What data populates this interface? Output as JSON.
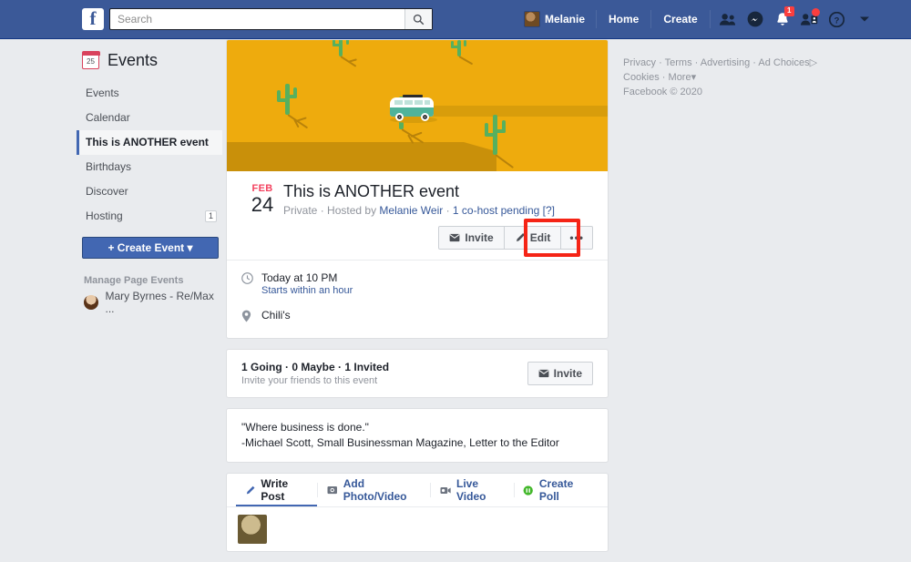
{
  "nav": {
    "logo": "f",
    "search_placeholder": "Search",
    "search_icon": "search-icon",
    "user_name": "Melanie",
    "home_label": "Home",
    "create_label": "Create",
    "friend_requests_icon": "friend-requests-icon",
    "messenger_icon": "messenger-icon",
    "notifications_icon": "notifications-icon",
    "notifications_badge": "1",
    "account_icon": "account-icon",
    "help_icon": "help-icon",
    "dropdown_icon": "chevron-down-icon"
  },
  "sidebar": {
    "title": "Events",
    "calendar_icon_day": "25",
    "items": [
      {
        "label": "Events",
        "selected": false,
        "badge": ""
      },
      {
        "label": "Calendar",
        "selected": false,
        "badge": ""
      },
      {
        "label": "This is ANOTHER event",
        "selected": true,
        "badge": ""
      },
      {
        "label": "Birthdays",
        "selected": false,
        "badge": ""
      },
      {
        "label": "Discover",
        "selected": false,
        "badge": ""
      },
      {
        "label": "Hosting",
        "selected": false,
        "badge": "1"
      }
    ],
    "create_event_button": "+  Create Event  ▾",
    "manage_label": "Manage Page Events",
    "pages": [
      {
        "name": "Mary Byrnes - Re/Max ..."
      }
    ]
  },
  "event": {
    "cover_alt": "desert-cover-photo",
    "month": "FEB",
    "day": "24",
    "title": "This is ANOTHER event",
    "privacy": "Private",
    "hosted_by_prefix": "Hosted by",
    "host_name": "Melanie Weir",
    "cohost_pending": "1 co-host pending [?]",
    "separator": "·",
    "invite_button": "Invite",
    "edit_button": "Edit",
    "more_button": "•••",
    "highlight_color": "#f52416",
    "time_text": "Today at 10 PM",
    "time_sub": "Starts within an hour",
    "location": "Chili's",
    "clock_icon": "clock-icon",
    "pin_icon": "location-pin-icon",
    "envelope_icon": "envelope-icon",
    "pencil_icon": "pencil-icon"
  },
  "going": {
    "summary": "1 Going · 0 Maybe · 1 Invited",
    "sub": "Invite your friends to this event",
    "invite_button": "Invite"
  },
  "description": {
    "line1": "\"Where business is done.\"",
    "line2": "-Michael Scott, Small Businessman Magazine, Letter to the Editor"
  },
  "composer": {
    "tabs": [
      {
        "label": "Write Post",
        "icon": "pencil-icon",
        "active": true
      },
      {
        "label": "Add Photo/Video",
        "icon": "photo-icon",
        "active": false
      },
      {
        "label": "Live Video",
        "icon": "video-camera-icon",
        "active": false
      },
      {
        "label": "Create Poll",
        "icon": "poll-icon",
        "active": false
      }
    ]
  },
  "footer": {
    "row1": [
      "Privacy",
      "Terms",
      "Advertising",
      "Ad Choices"
    ],
    "ad_choices_icon": "ad-choices-icon",
    "row2": [
      "Cookies",
      "More"
    ],
    "more_caret": "▾",
    "copyright": "Facebook © 2020"
  },
  "colors": {
    "nav_blue": "#3b5998",
    "accent_blue": "#4267b2",
    "link_blue": "#365899",
    "page_bg": "#e9ebee",
    "cover_sand": "#eeab0d",
    "cactus_green": "#57b05e",
    "van_teal": "#4fb39a",
    "date_red": "#f3425f"
  }
}
